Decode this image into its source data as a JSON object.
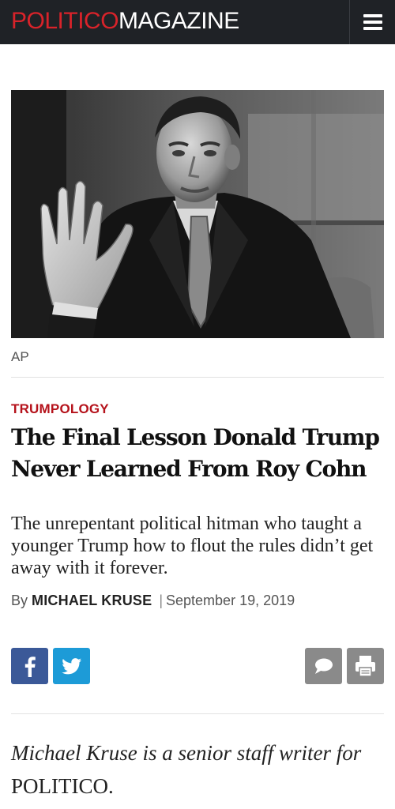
{
  "header": {
    "logo_primary": "POLITICO",
    "logo_secondary": "MAGAZINE",
    "menu_icon": "hamburger-menu-icon"
  },
  "hero": {
    "photo_credit": "AP"
  },
  "article": {
    "kicker": "TRUMPOLOGY",
    "headline": "The Final Lesson Donald Trump Never Learned From Roy Cohn",
    "dek": "The unrepentant political hitman who taught a younger Trump how to flout the rules didn’t get away with it forever.",
    "byline_prefix": "By",
    "author": "MICHAEL KRUSE",
    "separator": "|",
    "date": "September 19, 2019"
  },
  "share": {
    "facebook_icon": "facebook-icon",
    "twitter_icon": "twitter-icon",
    "comment_icon": "comment-icon",
    "print_icon": "print-icon"
  },
  "bio": {
    "text_italic": "Michael Kruse is a senior staff writer for",
    "outlet": "POLITICO."
  },
  "colors": {
    "topbar": "#1f2226",
    "brand_red": "#d8232a",
    "kicker_red": "#b5121b",
    "facebook": "#3b5998",
    "twitter": "#1d9bd7",
    "utility_gray": "#8a8a8a"
  }
}
